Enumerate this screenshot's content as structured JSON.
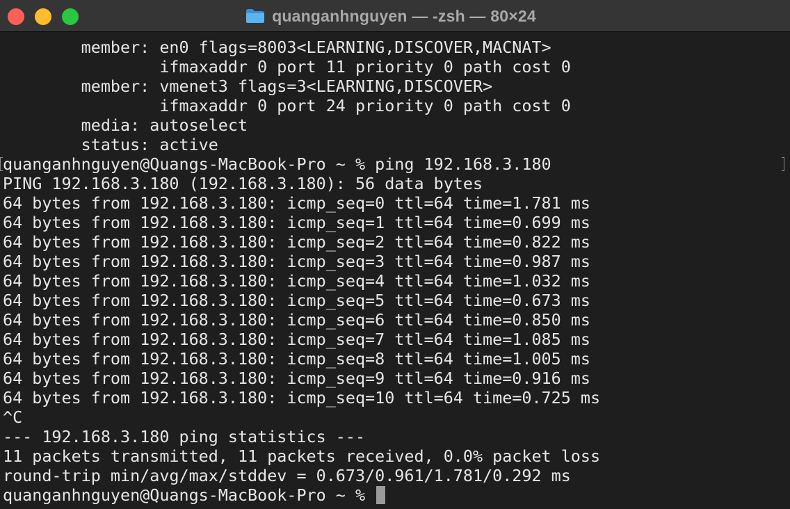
{
  "window": {
    "title": "quanganhnguyen — -zsh — 80×24",
    "folder_icon": "folder-icon"
  },
  "terminal": {
    "lines": [
      "        member: en0 flags=8003<LEARNING,DISCOVER,MACNAT>",
      "                ifmaxaddr 0 port 11 priority 0 path cost 0",
      "        member: vmenet3 flags=3<LEARNING,DISCOVER>",
      "                ifmaxaddr 0 port 24 priority 0 path cost 0",
      "        media: autoselect",
      "        status: active",
      "quanganhnguyen@Quangs-MacBook-Pro ~ % ping 192.168.3.180",
      "PING 192.168.3.180 (192.168.3.180): 56 data bytes",
      "64 bytes from 192.168.3.180: icmp_seq=0 ttl=64 time=1.781 ms",
      "64 bytes from 192.168.3.180: icmp_seq=1 ttl=64 time=0.699 ms",
      "64 bytes from 192.168.3.180: icmp_seq=2 ttl=64 time=0.822 ms",
      "64 bytes from 192.168.3.180: icmp_seq=3 ttl=64 time=0.987 ms",
      "64 bytes from 192.168.3.180: icmp_seq=4 ttl=64 time=1.032 ms",
      "64 bytes from 192.168.3.180: icmp_seq=5 ttl=64 time=0.673 ms",
      "64 bytes from 192.168.3.180: icmp_seq=6 ttl=64 time=0.850 ms",
      "64 bytes from 192.168.3.180: icmp_seq=7 ttl=64 time=1.085 ms",
      "64 bytes from 192.168.3.180: icmp_seq=8 ttl=64 time=1.005 ms",
      "64 bytes from 192.168.3.180: icmp_seq=9 ttl=64 time=0.916 ms",
      "64 bytes from 192.168.3.180: icmp_seq=10 ttl=64 time=0.725 ms",
      "^C",
      "--- 192.168.3.180 ping statistics ---",
      "11 packets transmitted, 11 packets received, 0.0% packet loss",
      "round-trip min/avg/max/stddev = 0.673/0.961/1.781/0.292 ms",
      "quanganhnguyen@Quangs-MacBook-Pro ~ % "
    ]
  },
  "colors": {
    "background": "#1e1e1e",
    "titlebar": "#353535",
    "text": "#e6e6e6",
    "title_text": "#a9a9a9",
    "close": "#fe5f57",
    "minimize": "#febc2e",
    "zoom": "#28c840",
    "folder": "#4aa8e8",
    "cursor": "#9a9a9a"
  }
}
